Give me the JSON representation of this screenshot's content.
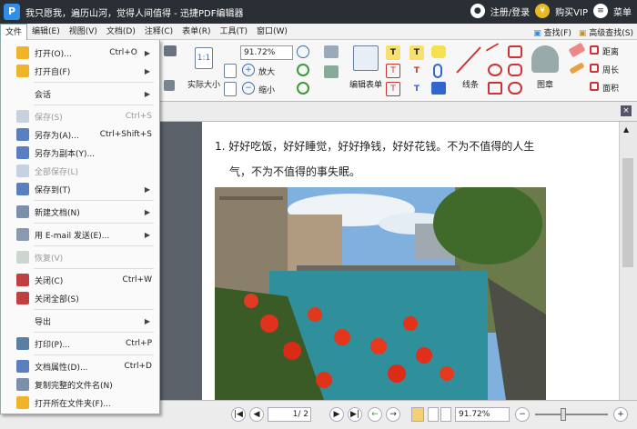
{
  "titlebar": {
    "title": "我只愿我，遍历山河，觉得人间值得 - 迅捷PDF编辑器",
    "login": "注册/登录",
    "vip": "购买VIP",
    "menu": "菜单",
    "logo_text": "P"
  },
  "menubar": {
    "items": [
      "文件",
      "编辑(E)",
      "视图(V)",
      "文档(D)",
      "注释(C)",
      "表单(R)",
      "工具(T)",
      "窗口(W)"
    ],
    "find": "查找(F)",
    "advanced_find": "高级查找(S)"
  },
  "ribbon": {
    "zoom": "91.72%",
    "actual_size": "实际大小",
    "zoom_in": "放大",
    "zoom_out": "缩小",
    "edit_form": "编辑表单",
    "lines": "线条",
    "stamp": "图章",
    "distance": "距离",
    "perimeter": "周长",
    "area": "面积"
  },
  "file_menu": [
    {
      "label": "打开(O)...",
      "shortcut": "Ctrl+O",
      "arrow": true,
      "icon": "folder-open-icon",
      "disabled": false
    },
    {
      "label": "打开自(F)",
      "shortcut": "",
      "arrow": true,
      "icon": "folder-icon",
      "disabled": false
    },
    {
      "label": "会话",
      "shortcut": "",
      "arrow": true,
      "icon": "",
      "disabled": false
    },
    {
      "label": "保存(S)",
      "shortcut": "Ctrl+S",
      "arrow": false,
      "icon": "save-icon",
      "disabled": true
    },
    {
      "label": "另存为(A)...",
      "shortcut": "Ctrl+Shift+S",
      "arrow": false,
      "icon": "save-as-icon",
      "disabled": false
    },
    {
      "label": "另存为副本(Y)...",
      "shortcut": "",
      "arrow": false,
      "icon": "save-copy-icon",
      "disabled": false
    },
    {
      "label": "全部保存(L)",
      "shortcut": "",
      "arrow": false,
      "icon": "save-all-icon",
      "disabled": true
    },
    {
      "label": "保存到(T)",
      "shortcut": "",
      "arrow": true,
      "icon": "save-to-icon",
      "disabled": false
    },
    {
      "label": "新建文档(N)",
      "shortcut": "",
      "arrow": true,
      "icon": "new-doc-icon",
      "disabled": false
    },
    {
      "label": "用 E-mail 发送(E)...",
      "shortcut": "",
      "arrow": true,
      "icon": "email-icon",
      "disabled": false
    },
    {
      "label": "恢复(V)",
      "shortcut": "",
      "arrow": false,
      "icon": "revert-icon",
      "disabled": true
    },
    {
      "label": "关闭(C)",
      "shortcut": "Ctrl+W",
      "arrow": false,
      "icon": "close-doc-icon",
      "disabled": false
    },
    {
      "label": "关闭全部(S)",
      "shortcut": "",
      "arrow": false,
      "icon": "close-all-icon",
      "disabled": false
    },
    {
      "label": "导出",
      "shortcut": "",
      "arrow": true,
      "icon": "",
      "disabled": false
    },
    {
      "label": "打印(P)...",
      "shortcut": "Ctrl+P",
      "arrow": false,
      "icon": "print-icon",
      "disabled": false
    },
    {
      "label": "文档属性(D)...",
      "shortcut": "Ctrl+D",
      "arrow": false,
      "icon": "properties-icon",
      "disabled": false
    },
    {
      "label": "复制完整的文件名(N)",
      "shortcut": "",
      "arrow": false,
      "icon": "copy-name-icon",
      "disabled": false
    },
    {
      "label": "打开所在文件夹(F)...",
      "shortcut": "",
      "arrow": false,
      "icon": "open-folder-icon",
      "disabled": false
    }
  ],
  "document": {
    "line1": "1. 好好吃饭，好好睡觉，好好挣钱，好好花钱。不为不值得的人生",
    "line2": "气，不为不值得的事失眠。"
  },
  "status": {
    "page_value": "1",
    "page_total": "/ 2",
    "zoom": "91.72%"
  },
  "colors": {
    "titlebar": "#2a2f35",
    "accent": "#2f8fe8",
    "vip": "#e8b820"
  }
}
